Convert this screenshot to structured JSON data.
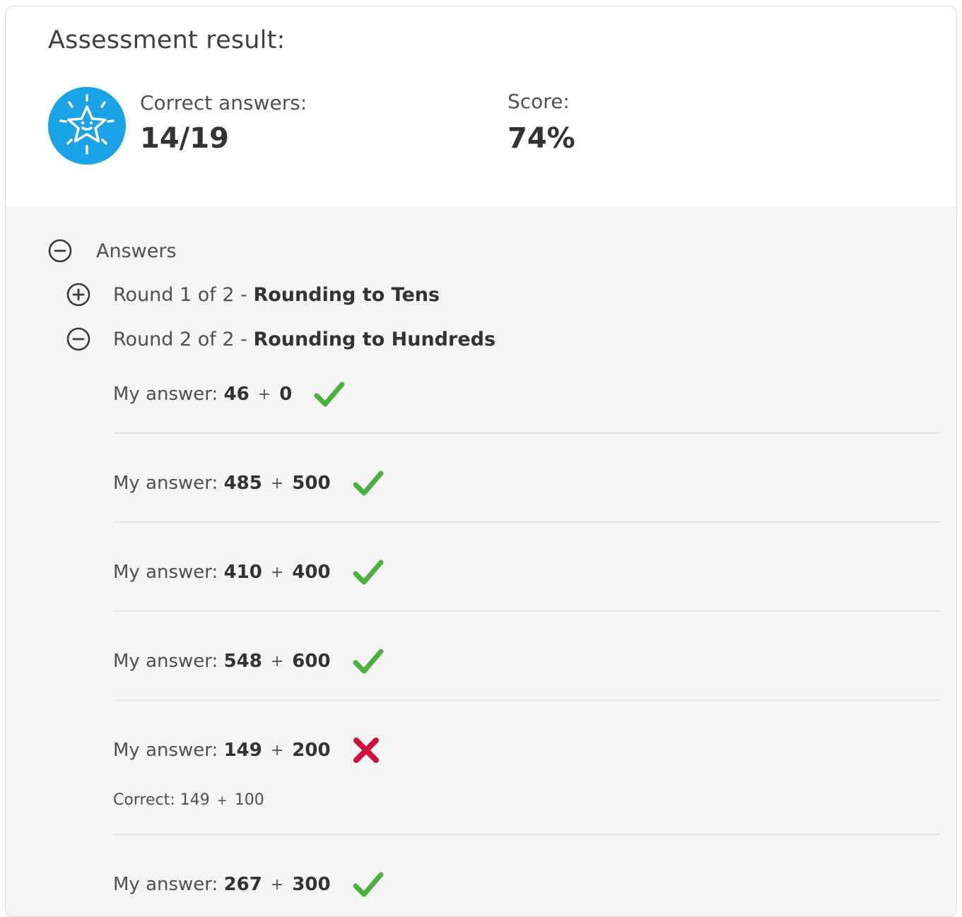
{
  "header": {
    "title": "Assessment result:",
    "correct_label": "Correct answers:",
    "correct_value": "14/19",
    "score_label": "Score:",
    "score_value": "74%",
    "badge_icon": "star-badge-icon"
  },
  "answers": {
    "toggle_label": "Answers",
    "rounds": [
      {
        "prefix": "Round 1 of 2 - ",
        "name": "Rounding to Tens",
        "expanded": false
      },
      {
        "prefix": "Round 2 of 2 - ",
        "name": "Rounding to Hundreds",
        "expanded": true
      }
    ],
    "my_answer_label": "My answer:",
    "correct_label": "Correct:",
    "items": [
      {
        "a": "46",
        "b": "0",
        "correct": true
      },
      {
        "a": "485",
        "b": "500",
        "correct": true
      },
      {
        "a": "410",
        "b": "400",
        "correct": true
      },
      {
        "a": "548",
        "b": "600",
        "correct": true
      },
      {
        "a": "149",
        "b": "200",
        "correct": false,
        "correct_a": "149",
        "correct_b": "100"
      },
      {
        "a": "267",
        "b": "300",
        "correct": true
      }
    ]
  },
  "colors": {
    "accent": "#1aa3e6",
    "check": "#4caf3f",
    "cross": "#d0103a"
  }
}
